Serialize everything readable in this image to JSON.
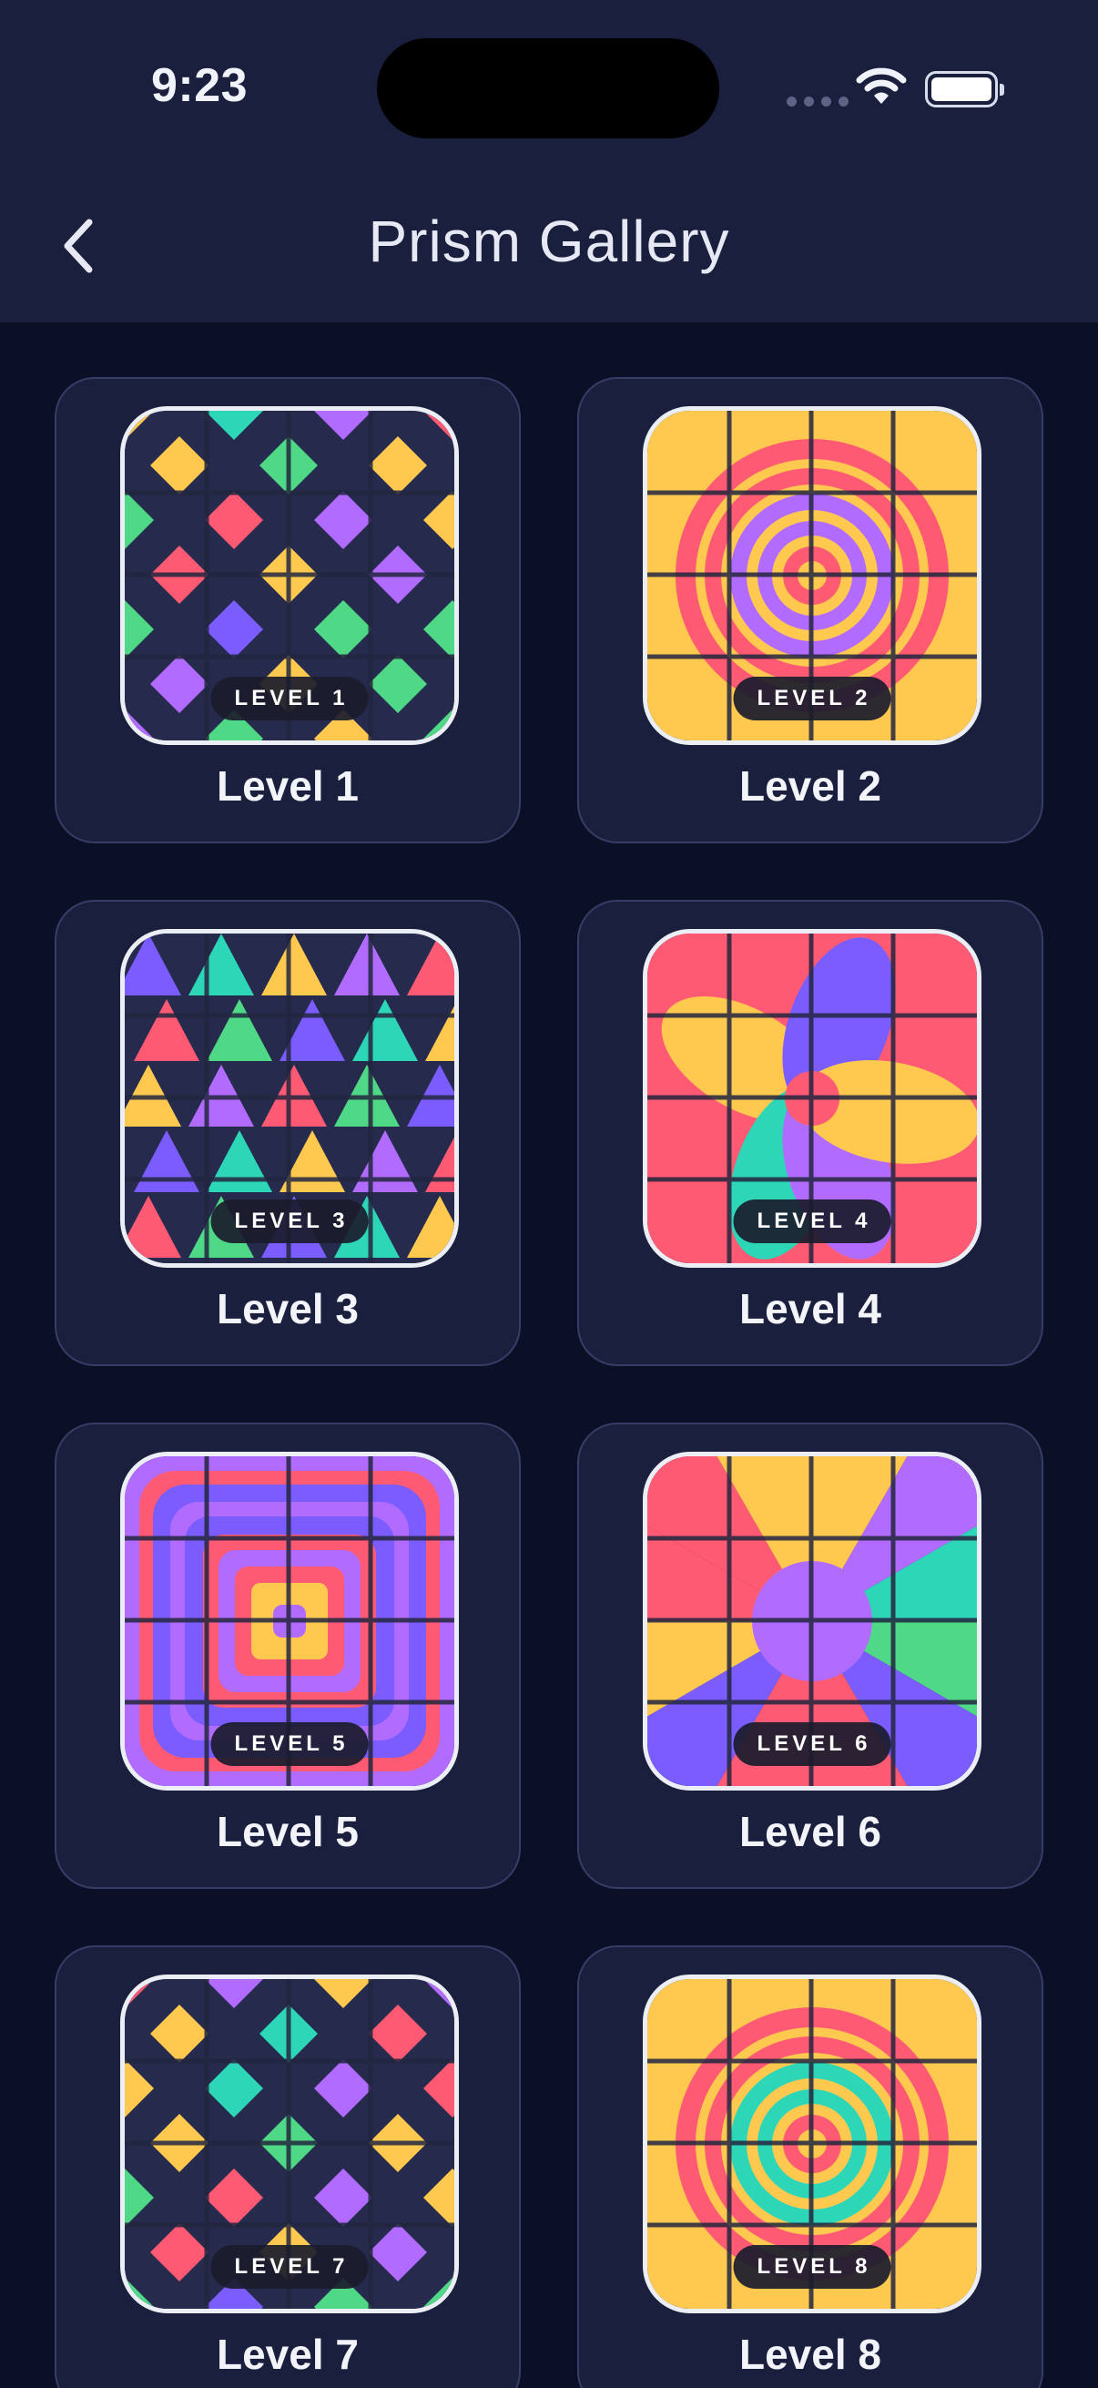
{
  "status": {
    "time": "9:23"
  },
  "header": {
    "title": "Prism Gallery"
  },
  "icons": {
    "back": "chevron-left-icon",
    "wifi": "wifi-icon",
    "battery": "battery-icon",
    "signal": "cellular-signal-icon"
  },
  "colors": {
    "background": "#0c1027",
    "header": "#1a1f3d",
    "card": "#1b1f3e",
    "teal": "#2ed6b8",
    "pink": "#ff5a73",
    "purple": "#b16cff",
    "violet": "#7b5cff",
    "yellow": "#ffc94f",
    "green": "#4fd986",
    "navy": "#262b4d"
  },
  "levels": [
    {
      "badge": "LEVEL 1",
      "label": "Level 1",
      "pattern": "diamonds"
    },
    {
      "badge": "LEVEL 2",
      "label": "Level 2",
      "pattern": "rings-pink-purple"
    },
    {
      "badge": "LEVEL 3",
      "label": "Level 3",
      "pattern": "triangles"
    },
    {
      "badge": "LEVEL 4",
      "label": "Level 4",
      "pattern": "petals"
    },
    {
      "badge": "LEVEL 5",
      "label": "Level 5",
      "pattern": "rounded-squares"
    },
    {
      "badge": "LEVEL 6",
      "label": "Level 6",
      "pattern": "sunburst"
    },
    {
      "badge": "LEVEL 7",
      "label": "Level 7",
      "pattern": "diamonds"
    },
    {
      "badge": "LEVEL 8",
      "label": "Level 8",
      "pattern": "rings-pink-teal"
    }
  ]
}
